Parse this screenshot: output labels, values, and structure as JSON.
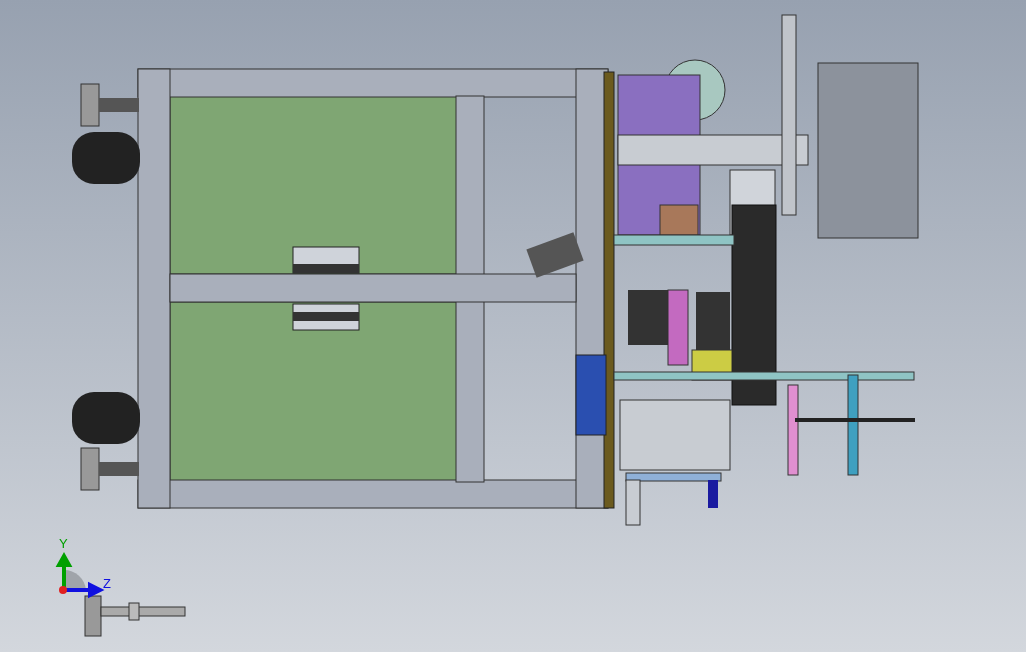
{
  "triad": {
    "axes": [
      {
        "label": "Y",
        "color": "#00a000"
      },
      {
        "label": "Z",
        "color": "#1010e0"
      }
    ]
  }
}
